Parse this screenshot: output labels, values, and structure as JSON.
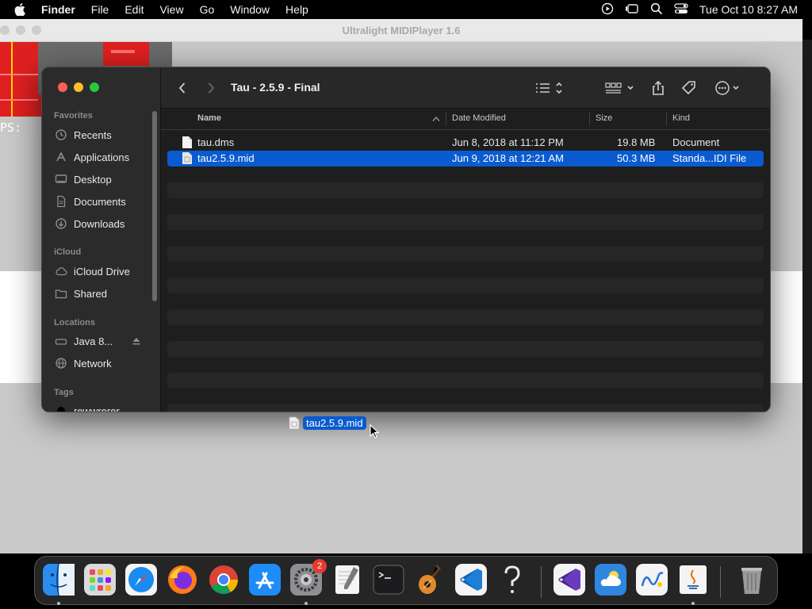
{
  "menubar": {
    "app_name": "Finder",
    "menus": [
      "File",
      "Edit",
      "View",
      "Go",
      "Window",
      "Help"
    ],
    "datetime": "Tue Oct 10  8:27 AM"
  },
  "back_window": {
    "title": "Ultralight MIDIPlayer 1.6",
    "fps_label": "PS:"
  },
  "finder": {
    "title": "Tau - 2.5.9 - Final",
    "sidebar": {
      "favorites_label": "Favorites",
      "favorites": [
        "Recents",
        "Applications",
        "Desktop",
        "Documents",
        "Downloads"
      ],
      "icloud_label": "iCloud",
      "icloud": [
        "iCloud Drive",
        "Shared"
      ],
      "locations_label": "Locations",
      "locations": [
        "Java 8...",
        "Network"
      ],
      "tags_label": "Tags",
      "tags": [
        "rewwrerer"
      ]
    },
    "columns": {
      "name": "Name",
      "date": "Date Modified",
      "size": "Size",
      "kind": "Kind"
    },
    "files": [
      {
        "name": "tau.dms",
        "date": "Jun 8, 2018 at 11:12 PM",
        "size": "19.8 MB",
        "kind": "Document",
        "selected": false
      },
      {
        "name": "tau2.5.9.mid",
        "date": "Jun 9, 2018 at 12:21 AM",
        "size": "50.3 MB",
        "kind": "Standa...IDI File",
        "selected": true
      }
    ]
  },
  "drag": {
    "label": "tau2.5.9.mid"
  },
  "dock": {
    "apps": [
      "finder-icon",
      "launchpad-icon",
      "safari-icon",
      "firefox-icon",
      "chrome-icon",
      "app-store-icon",
      "system-settings-icon",
      "textedit-icon",
      "terminal-icon",
      "garageband-icon",
      "vscode-icon",
      "help-icon",
      "visual-studio-icon",
      "weather-icon",
      "freeform-icon",
      "java-icon",
      "trash-icon"
    ],
    "settings_badge": "2"
  },
  "colors": {
    "accent": "#0a5bd0",
    "close": "#ff5f57",
    "minimize": "#febc2e",
    "zoom": "#28c840"
  }
}
